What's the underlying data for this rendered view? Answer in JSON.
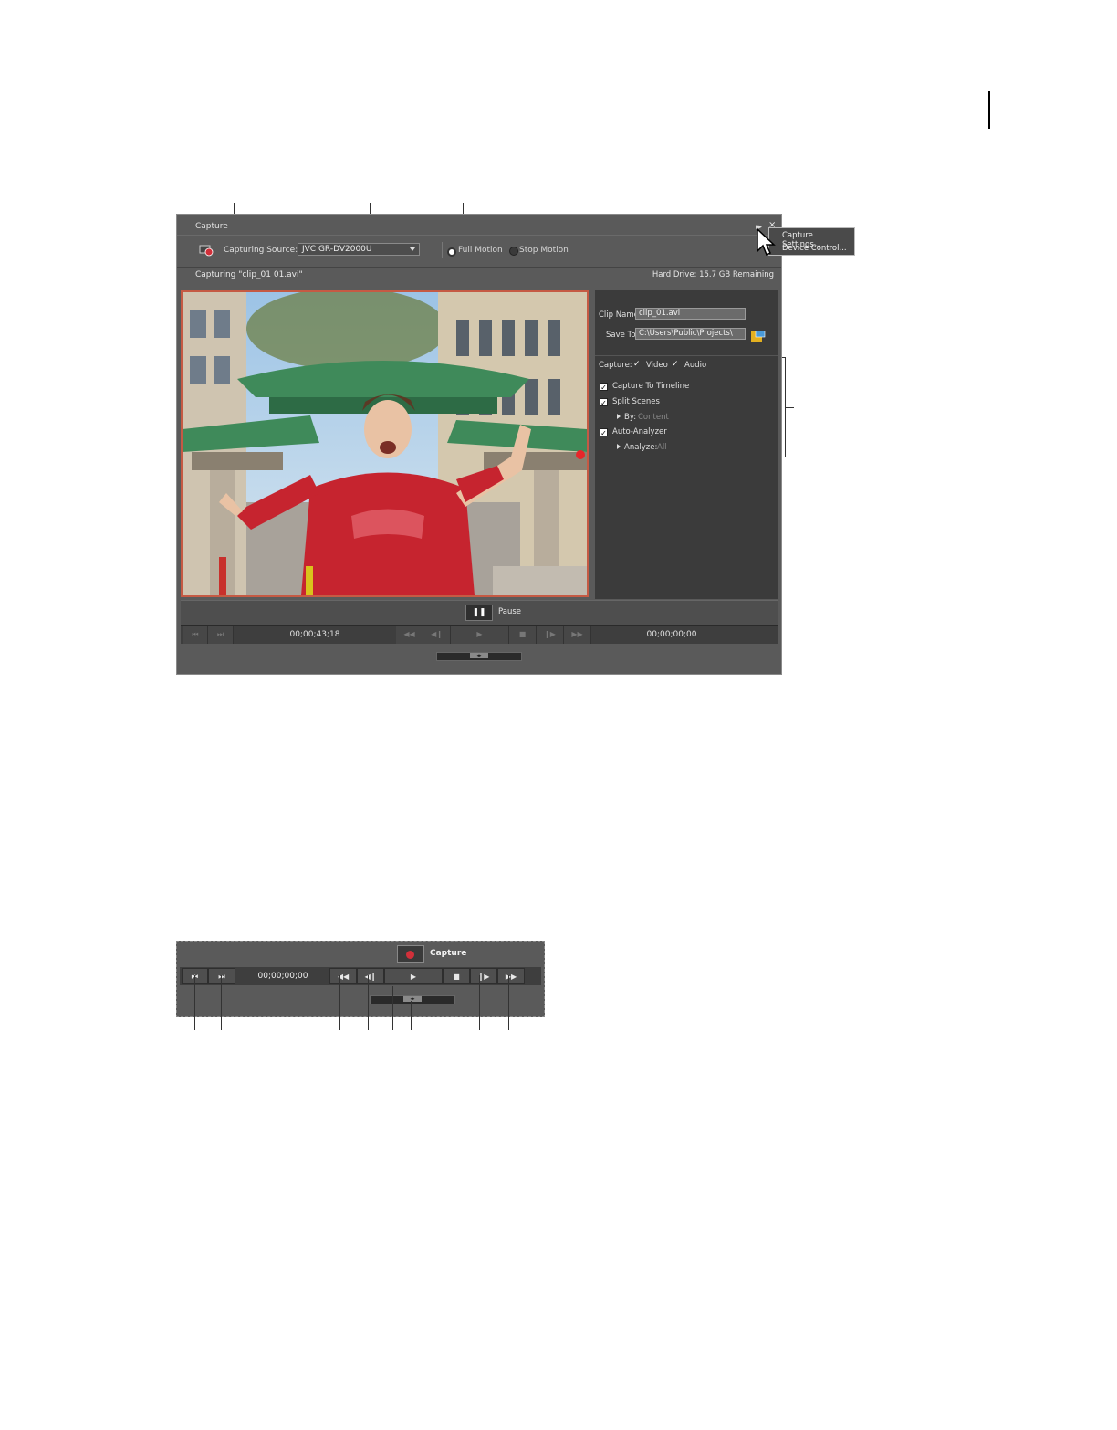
{
  "capture_panel": {
    "title": "Capture",
    "capturing_source_label": "Capturing Source:",
    "capturing_source_value": "JVC GR-DV2000U",
    "mode_full_motion": "Full Motion",
    "mode_stop_motion": "Stop Motion",
    "mode_selected": "Full Motion",
    "menu_arrows": "▸▸",
    "close": "×",
    "status": "Capturing \"clip_01 01.avi\"",
    "hard_drive": "Hard Drive: 15.7 GB Remaining",
    "clip_name_label": "Clip Name",
    "clip_name_value": "clip_01.avi",
    "save_to_label": "Save To:",
    "save_to_value": "C:\\Users\\Public\\Projects\\",
    "capture_label": "Capture:",
    "video_label": "Video",
    "audio_label": "Audio",
    "capture_to_timeline": "Capture To Timeline",
    "split_scenes": "Split Scenes",
    "by_label": "By:",
    "by_value": "Content",
    "auto_analyzer": "Auto-Analyzer",
    "analyze_label": "Analyze:",
    "analyze_value": "All",
    "pause_icon": "❚❚",
    "pause_label": "Pause",
    "timecode_left": "00;00;43;18",
    "timecode_right": "00;00;00;00",
    "transport_icons": {
      "go_to_start": "⏮",
      "go_to_end": "⏭",
      "rewind": "◀◀",
      "step_back": "◀❙",
      "play": "▶",
      "stop": "■",
      "step_forward": "❙▶",
      "fast_forward": "▶▶"
    }
  },
  "context_menu": {
    "items": [
      "Capture Settings...",
      "Device Control..."
    ]
  },
  "capture_strip": {
    "capture_label": "Capture",
    "timecode": "00;00;00;00",
    "icons": {
      "go_to_start": "⏮",
      "go_to_end": "⏭",
      "rewind": "◀◀",
      "step_back": "◀❙",
      "play": "▶",
      "stop": "■",
      "step_forward": "❙▶",
      "fast_forward": "▶▶"
    }
  },
  "colors": {
    "panel_bg": "#5a5a5a",
    "side_panel_bg": "#3b3b3b",
    "video_border": "#c55a44",
    "record_red": "#d1303a"
  }
}
